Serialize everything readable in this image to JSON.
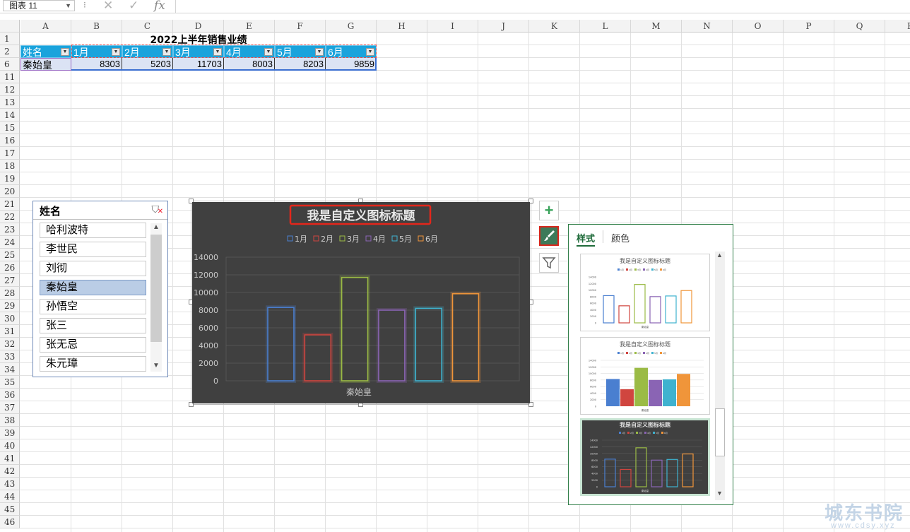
{
  "formula_bar": {
    "name_box": "图表 11",
    "cancel": "✕",
    "enter": "✓",
    "fx": "fx"
  },
  "columns": [
    "A",
    "B",
    "C",
    "D",
    "E",
    "F",
    "G",
    "H",
    "I",
    "J",
    "K",
    "L",
    "M",
    "N",
    "O",
    "P",
    "Q",
    "R"
  ],
  "rows": [
    "1",
    "2",
    "6",
    "11",
    "12",
    "13",
    "14",
    "15",
    "16",
    "17",
    "18",
    "19",
    "20",
    "21",
    "22",
    "23",
    "24",
    "25",
    "26",
    "27",
    "28",
    "29",
    "30",
    "31",
    "32",
    "33",
    "34",
    "35",
    "36",
    "37",
    "38",
    "39",
    "40",
    "41",
    "42",
    "43",
    "44",
    "45",
    "46"
  ],
  "sheet": {
    "title": "2022上半年销售业绩",
    "headers": [
      "姓名",
      "1月",
      "2月",
      "3月",
      "4月",
      "5月",
      "6月"
    ],
    "name": "秦始皇",
    "values": [
      "8303",
      "5203",
      "11703",
      "8003",
      "8203",
      "9859"
    ]
  },
  "slicer": {
    "title": "姓名",
    "items": [
      "哈利波特",
      "李世民",
      "刘彻",
      "秦始皇",
      "孙悟空",
      "张三",
      "张无忌",
      "朱元璋"
    ],
    "selected": "秦始皇"
  },
  "chart_data": {
    "type": "bar",
    "title": "我是自定义图标标题",
    "categories": [
      "秦始皇"
    ],
    "series": [
      {
        "name": "1月",
        "values": [
          8303
        ]
      },
      {
        "name": "2月",
        "values": [
          5203
        ]
      },
      {
        "name": "3月",
        "values": [
          11703
        ]
      },
      {
        "name": "4月",
        "values": [
          8003
        ]
      },
      {
        "name": "5月",
        "values": [
          8203
        ]
      },
      {
        "name": "6月",
        "values": [
          9859
        ]
      }
    ],
    "colors": [
      "#4a7fd0",
      "#d0453f",
      "#9bbb45",
      "#8a64b4",
      "#3fb2cf",
      "#f0953a"
    ],
    "ylim": [
      0,
      14000
    ],
    "yticks": [
      "0",
      "2000",
      "4000",
      "6000",
      "8000",
      "10000",
      "12000",
      "14000"
    ],
    "xlabel": "秦始皇",
    "ylabel": "",
    "legend": "top",
    "style": "outlined bars, dark background"
  },
  "panel": {
    "tab_style": "样式",
    "tab_color": "颜色",
    "thumbnail_title": "我是自定义图标标题",
    "thumbnail_xlabel": "秦始皇",
    "thumbnail_legend": [
      "1月",
      "2月",
      "3月",
      "4月",
      "5月",
      "6月"
    ],
    "thumbnail_yticks": [
      "0",
      "2000",
      "4000",
      "6000",
      "8000",
      "10000",
      "12000",
      "14000"
    ]
  },
  "watermark": {
    "text": "城东书院",
    "url": "www.cdsy.xyz"
  },
  "icons": {
    "plus": "+",
    "brush": "brush-icon",
    "filter": "filter-icon"
  }
}
